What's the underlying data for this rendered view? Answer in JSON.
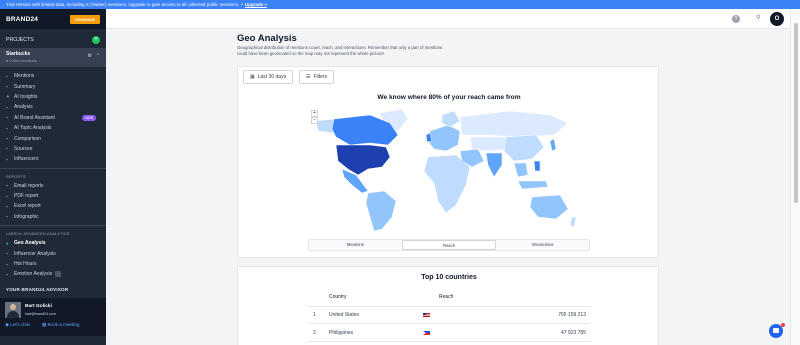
{
  "banner": {
    "text": "Trial Version with limited data, including X (Twitter) mentions. Upgrade to gain access to all collected public mentions. ⚡",
    "link": "Upgrade »"
  },
  "sidebar": {
    "logo": "BRAND24",
    "upgrade": "UPGRADE",
    "projects_label": "PROJECTS",
    "project": {
      "name": "Starbucks",
      "sub": "● 0 New mentions"
    },
    "items": [
      {
        "label": "Mentions",
        "icon": "chat-icon"
      },
      {
        "label": "Summary",
        "icon": "home-icon"
      },
      {
        "label": "AI Insights",
        "icon": "sparkle-icon"
      },
      {
        "label": "Analysis",
        "icon": "chart-icon"
      },
      {
        "label": "AI Brand Assistant",
        "icon": "robot-icon",
        "badge": "NEW"
      },
      {
        "label": "AI Topic Analysis",
        "icon": "topic-icon"
      },
      {
        "label": "Comparison",
        "icon": "compare-icon"
      },
      {
        "label": "Sources",
        "icon": "sources-icon"
      },
      {
        "label": "Influencers",
        "icon": "users-icon"
      }
    ],
    "reports_label": "REPORTS",
    "reports": [
      {
        "label": "Email reports",
        "icon": "email-icon"
      },
      {
        "label": "PDF report",
        "icon": "pdf-icon"
      },
      {
        "label": "Excel report",
        "icon": "excel-icon"
      },
      {
        "label": "Infographic",
        "icon": "image-icon"
      }
    ],
    "labs_label": "LABS24: ADVANCED ANALYTICS",
    "labs": [
      {
        "label": "Geo Analysis",
        "icon": "globe-icon",
        "active": true
      },
      {
        "label": "Influencer Analysis",
        "icon": "influencer-icon"
      },
      {
        "label": "Hot Hours",
        "icon": "clock-icon"
      },
      {
        "label": "Emotion Analysis",
        "icon": "emotion-icon"
      }
    ],
    "advisor_label": "YOUR BRAND24 ADVISOR",
    "advisor": {
      "name": "Bart Golicki",
      "email": "bart@brand24.com",
      "chat": "Let's chat",
      "book": "Book a meeting"
    }
  },
  "topbar": {
    "user_initial": "O",
    "help": "?"
  },
  "page": {
    "title": "Geo Analysis",
    "description": "Geographical distribution of mentions count, reach, and interactions. Remember that only a part of mentions could have been geolocated so the map may not represent the whole picture!"
  },
  "filters": {
    "date": "Last 30 days",
    "filters": "Filters"
  },
  "map": {
    "headline": "We know where 80% of your reach came from",
    "zoom_in": "+",
    "zoom_out": "−",
    "tabs": [
      "Mentions",
      "Reach",
      "Interactions"
    ],
    "selected_tab": "Reach",
    "colors": {
      "high": "#1e40af",
      "mid": "#3b82f6",
      "low": "#93c5fd",
      "none": "#dbeafe"
    }
  },
  "top_countries": {
    "title": "Top 10 countries",
    "columns": [
      "Country",
      "Reach"
    ],
    "rows": [
      {
        "rank": "1",
        "country": "United States",
        "reach": "765 159 213"
      },
      {
        "rank": "2",
        "country": "Philippines",
        "reach": "47 923 785"
      }
    ]
  }
}
